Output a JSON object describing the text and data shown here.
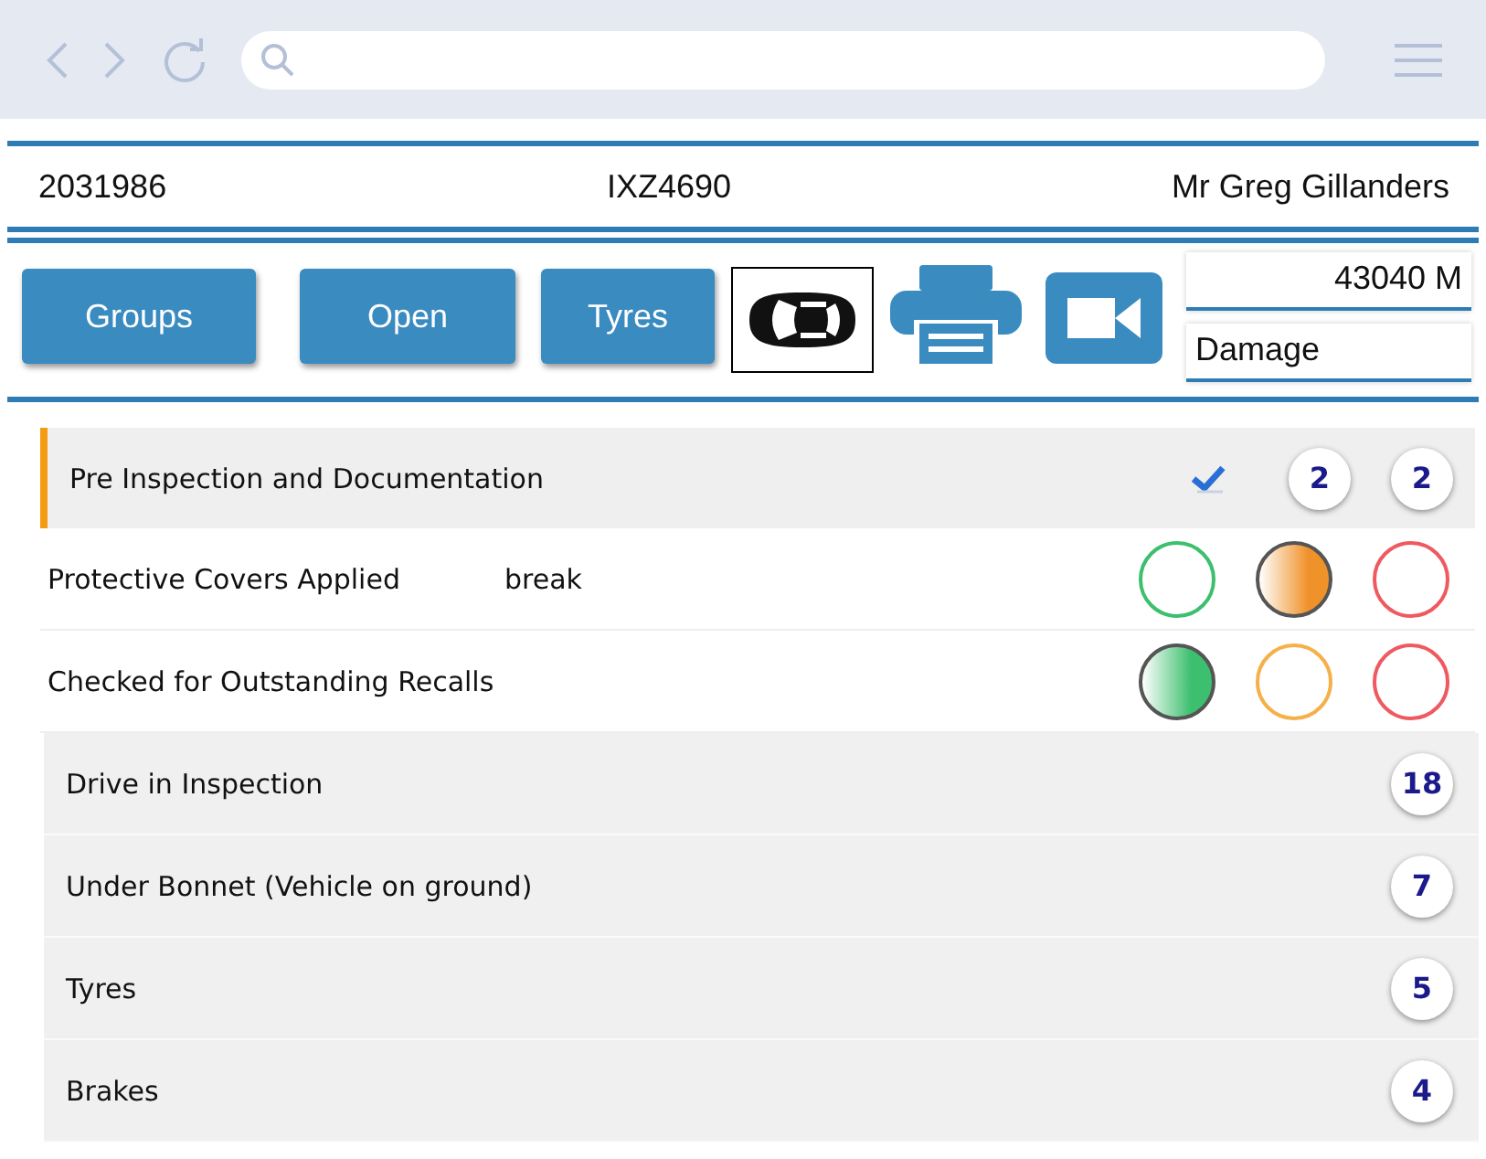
{
  "header": {
    "job_number": "2031986",
    "registration": "IXZ4690",
    "customer": "Mr Greg Gillanders"
  },
  "toolbar": {
    "buttons": [
      {
        "label": "Groups",
        "kind": "text"
      },
      {
        "label": "Open",
        "kind": "text"
      },
      {
        "label": "Tyres",
        "kind": "text"
      },
      {
        "kind": "car"
      },
      {
        "kind": "printer"
      },
      {
        "kind": "video"
      }
    ],
    "mileage": "43040 M",
    "damage": "Damage"
  },
  "section": {
    "title": "Pre Inspection and Documentation",
    "checked": true,
    "counts": [
      "2",
      "2"
    ],
    "items": [
      {
        "label": "Protective Covers Applied",
        "note": "break",
        "ratings": [
          {
            "color": "#3cbf6e",
            "selected": false
          },
          {
            "color": "#f0922a",
            "selected": true
          },
          {
            "color": "#ee5a5f",
            "selected": false
          }
        ]
      },
      {
        "label": "Checked for Outstanding Recalls",
        "ratings": [
          {
            "color": "#3cbf6e",
            "selected": true
          },
          {
            "color": "#f6b04a",
            "selected": false
          },
          {
            "color": "#ee5a5f",
            "selected": false
          }
        ]
      }
    ]
  },
  "groups": [
    {
      "title": "Drive in Inspection",
      "count": "18"
    },
    {
      "title": "Under Bonnet (Vehicle on ground)",
      "count": "7"
    },
    {
      "title": "Tyres",
      "count": "5"
    },
    {
      "title": "Brakes",
      "count": "4"
    }
  ]
}
